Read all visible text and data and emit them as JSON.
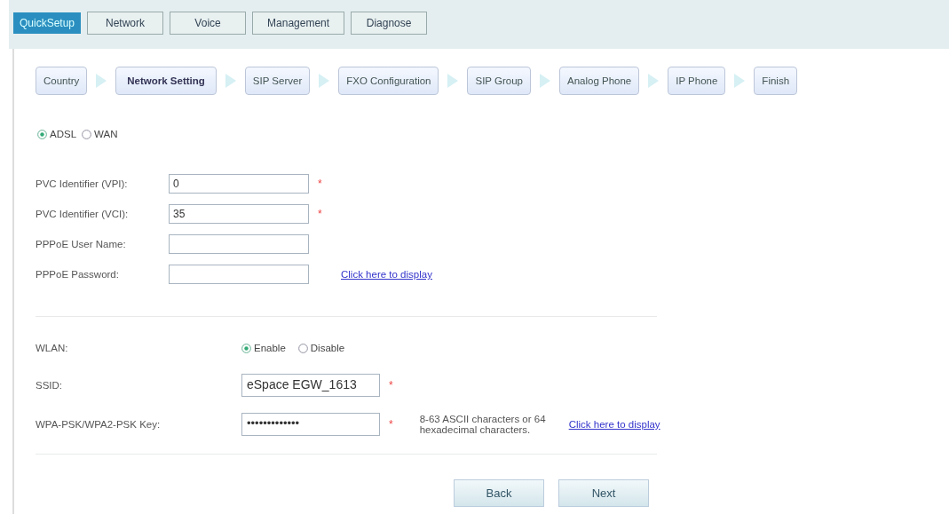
{
  "tabs": [
    {
      "label": "QuickSetup",
      "selected": true
    },
    {
      "label": "Network",
      "selected": false
    },
    {
      "label": "Voice",
      "selected": false
    },
    {
      "label": "Management",
      "selected": false
    },
    {
      "label": "Diagnose",
      "selected": false
    }
  ],
  "steps": [
    {
      "label": "Country",
      "selected": false
    },
    {
      "label": "Network Setting",
      "selected": true
    },
    {
      "label": "SIP Server",
      "selected": false
    },
    {
      "label": "FXO Configuration",
      "selected": false
    },
    {
      "label": "SIP Group",
      "selected": false
    },
    {
      "label": "Analog Phone",
      "selected": false
    },
    {
      "label": "IP Phone",
      "selected": false
    },
    {
      "label": "Finish",
      "selected": false
    }
  ],
  "mode": [
    {
      "label": "ADSL",
      "selected": true
    },
    {
      "label": "WAN",
      "selected": false
    }
  ],
  "adsl_fields": [
    {
      "label": "PVC Identifier (VPI):",
      "value": "0",
      "mark": "*"
    },
    {
      "label": "PVC Identifier (VCI):",
      "value": "35",
      "mark": "*"
    },
    {
      "label": "PPPoE User Name:"
    },
    {
      "label": "PPPoE Password:",
      "link": "Click here to display"
    }
  ],
  "wlan": {
    "label": "WLAN:",
    "options": [
      {
        "label": "Enable",
        "selected": true
      },
      {
        "label": "Disable",
        "selected": false
      }
    ]
  },
  "ssid": {
    "label": "SSID:",
    "value": "eSpace EGW_1613",
    "mark": "*"
  },
  "key": {
    "label": "WPA-PSK/WPA2-PSK Key:",
    "value": "•••••••••••••",
    "mark": "*",
    "hint": "8-63 ASCII characters or 64 hexadecimal characters.",
    "link": "Click here to display"
  },
  "buttons": [
    "Back",
    "Next"
  ]
}
